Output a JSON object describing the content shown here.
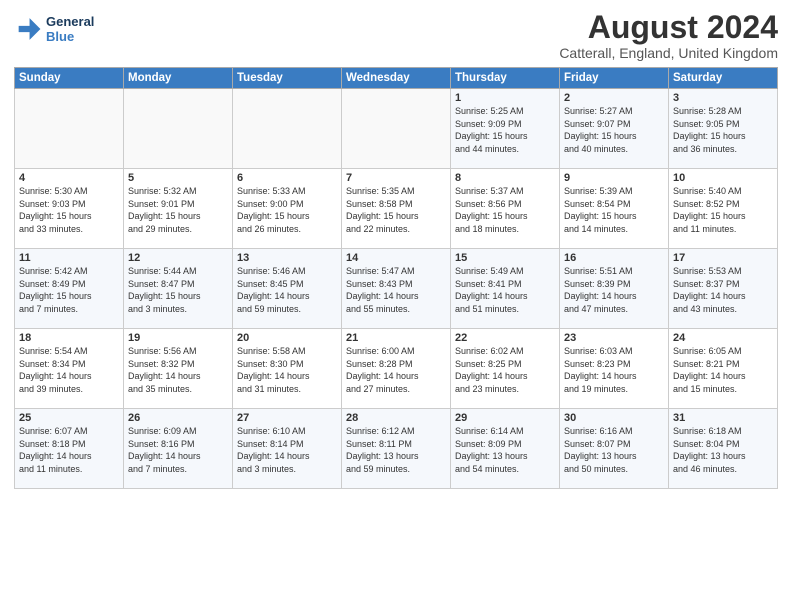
{
  "header": {
    "logo_line1": "General",
    "logo_line2": "Blue",
    "month_title": "August 2024",
    "location": "Catterall, England, United Kingdom"
  },
  "days_of_week": [
    "Sunday",
    "Monday",
    "Tuesday",
    "Wednesday",
    "Thursday",
    "Friday",
    "Saturday"
  ],
  "weeks": [
    [
      {
        "day": "",
        "info": ""
      },
      {
        "day": "",
        "info": ""
      },
      {
        "day": "",
        "info": ""
      },
      {
        "day": "",
        "info": ""
      },
      {
        "day": "1",
        "info": "Sunrise: 5:25 AM\nSunset: 9:09 PM\nDaylight: 15 hours\nand 44 minutes."
      },
      {
        "day": "2",
        "info": "Sunrise: 5:27 AM\nSunset: 9:07 PM\nDaylight: 15 hours\nand 40 minutes."
      },
      {
        "day": "3",
        "info": "Sunrise: 5:28 AM\nSunset: 9:05 PM\nDaylight: 15 hours\nand 36 minutes."
      }
    ],
    [
      {
        "day": "4",
        "info": "Sunrise: 5:30 AM\nSunset: 9:03 PM\nDaylight: 15 hours\nand 33 minutes."
      },
      {
        "day": "5",
        "info": "Sunrise: 5:32 AM\nSunset: 9:01 PM\nDaylight: 15 hours\nand 29 minutes."
      },
      {
        "day": "6",
        "info": "Sunrise: 5:33 AM\nSunset: 9:00 PM\nDaylight: 15 hours\nand 26 minutes."
      },
      {
        "day": "7",
        "info": "Sunrise: 5:35 AM\nSunset: 8:58 PM\nDaylight: 15 hours\nand 22 minutes."
      },
      {
        "day": "8",
        "info": "Sunrise: 5:37 AM\nSunset: 8:56 PM\nDaylight: 15 hours\nand 18 minutes."
      },
      {
        "day": "9",
        "info": "Sunrise: 5:39 AM\nSunset: 8:54 PM\nDaylight: 15 hours\nand 14 minutes."
      },
      {
        "day": "10",
        "info": "Sunrise: 5:40 AM\nSunset: 8:52 PM\nDaylight: 15 hours\nand 11 minutes."
      }
    ],
    [
      {
        "day": "11",
        "info": "Sunrise: 5:42 AM\nSunset: 8:49 PM\nDaylight: 15 hours\nand 7 minutes."
      },
      {
        "day": "12",
        "info": "Sunrise: 5:44 AM\nSunset: 8:47 PM\nDaylight: 15 hours\nand 3 minutes."
      },
      {
        "day": "13",
        "info": "Sunrise: 5:46 AM\nSunset: 8:45 PM\nDaylight: 14 hours\nand 59 minutes."
      },
      {
        "day": "14",
        "info": "Sunrise: 5:47 AM\nSunset: 8:43 PM\nDaylight: 14 hours\nand 55 minutes."
      },
      {
        "day": "15",
        "info": "Sunrise: 5:49 AM\nSunset: 8:41 PM\nDaylight: 14 hours\nand 51 minutes."
      },
      {
        "day": "16",
        "info": "Sunrise: 5:51 AM\nSunset: 8:39 PM\nDaylight: 14 hours\nand 47 minutes."
      },
      {
        "day": "17",
        "info": "Sunrise: 5:53 AM\nSunset: 8:37 PM\nDaylight: 14 hours\nand 43 minutes."
      }
    ],
    [
      {
        "day": "18",
        "info": "Sunrise: 5:54 AM\nSunset: 8:34 PM\nDaylight: 14 hours\nand 39 minutes."
      },
      {
        "day": "19",
        "info": "Sunrise: 5:56 AM\nSunset: 8:32 PM\nDaylight: 14 hours\nand 35 minutes."
      },
      {
        "day": "20",
        "info": "Sunrise: 5:58 AM\nSunset: 8:30 PM\nDaylight: 14 hours\nand 31 minutes."
      },
      {
        "day": "21",
        "info": "Sunrise: 6:00 AM\nSunset: 8:28 PM\nDaylight: 14 hours\nand 27 minutes."
      },
      {
        "day": "22",
        "info": "Sunrise: 6:02 AM\nSunset: 8:25 PM\nDaylight: 14 hours\nand 23 minutes."
      },
      {
        "day": "23",
        "info": "Sunrise: 6:03 AM\nSunset: 8:23 PM\nDaylight: 14 hours\nand 19 minutes."
      },
      {
        "day": "24",
        "info": "Sunrise: 6:05 AM\nSunset: 8:21 PM\nDaylight: 14 hours\nand 15 minutes."
      }
    ],
    [
      {
        "day": "25",
        "info": "Sunrise: 6:07 AM\nSunset: 8:18 PM\nDaylight: 14 hours\nand 11 minutes."
      },
      {
        "day": "26",
        "info": "Sunrise: 6:09 AM\nSunset: 8:16 PM\nDaylight: 14 hours\nand 7 minutes."
      },
      {
        "day": "27",
        "info": "Sunrise: 6:10 AM\nSunset: 8:14 PM\nDaylight: 14 hours\nand 3 minutes."
      },
      {
        "day": "28",
        "info": "Sunrise: 6:12 AM\nSunset: 8:11 PM\nDaylight: 13 hours\nand 59 minutes."
      },
      {
        "day": "29",
        "info": "Sunrise: 6:14 AM\nSunset: 8:09 PM\nDaylight: 13 hours\nand 54 minutes."
      },
      {
        "day": "30",
        "info": "Sunrise: 6:16 AM\nSunset: 8:07 PM\nDaylight: 13 hours\nand 50 minutes."
      },
      {
        "day": "31",
        "info": "Sunrise: 6:18 AM\nSunset: 8:04 PM\nDaylight: 13 hours\nand 46 minutes."
      }
    ]
  ]
}
